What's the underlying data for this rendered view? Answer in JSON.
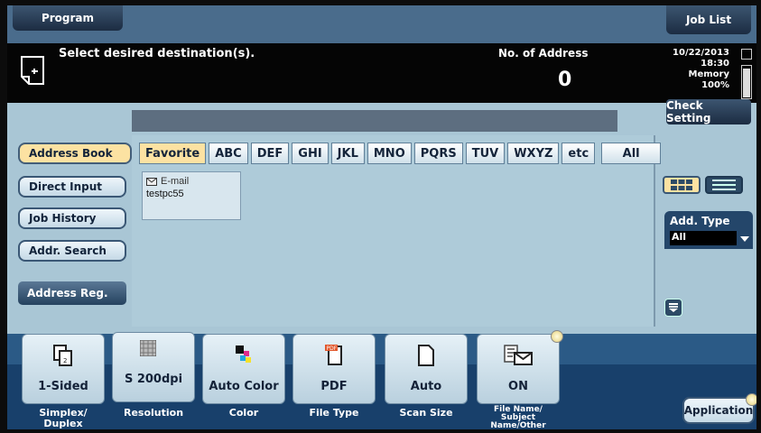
{
  "header": {
    "program_label": "Program",
    "job_list_label": "Job List",
    "message": "Select desired destination(s).",
    "no_of_address_label": "No. of Address",
    "no_of_address_value": "0",
    "date": "10/22/2013",
    "time": "18:30",
    "memory_label": "Memory",
    "memory_value": "100%",
    "check_setting_label": "Check Setting"
  },
  "sidebar": {
    "items": [
      {
        "label": "Address Book",
        "selected": true
      },
      {
        "label": "Direct Input",
        "selected": false
      },
      {
        "label": "Job History",
        "selected": false
      },
      {
        "label": "Addr. Search",
        "selected": false
      }
    ],
    "address_reg_label": "Address Reg."
  },
  "index_tabs": [
    "Favorite",
    "ABC",
    "DEF",
    "GHI",
    "JKL",
    "MNO",
    "PQRS",
    "TUV",
    "WXYZ",
    "etc",
    "All"
  ],
  "selected_tab": "Favorite",
  "destinations": [
    {
      "type": "E-mail",
      "name": "testpc55",
      "icon": "mail-icon"
    }
  ],
  "right_panel": {
    "add_type_label": "Add. Type",
    "add_type_value": "All"
  },
  "bottom_settings": [
    {
      "value": "1-Sided",
      "label": "Simplex/ Duplex",
      "icon": "duplex-icon"
    },
    {
      "value": "S 200dpi",
      "label": "Resolution",
      "icon": "resolution-icon"
    },
    {
      "value": "Auto Color",
      "label": "Color",
      "icon": "color-icon"
    },
    {
      "value": "PDF",
      "label": "File Type",
      "icon": "pdf-icon"
    },
    {
      "value": "Auto",
      "label": "Scan Size",
      "icon": "page-icon"
    },
    {
      "value": "ON",
      "label": "File Name/ Subject Name/Other",
      "icon": "file-mail-icon"
    }
  ],
  "application_label": "Application",
  "colors": {
    "screen_bg": "#a9c6d5",
    "selected_tab": "#fce2a2",
    "dark_button": "#1c2c42",
    "message_band": "#050505"
  }
}
